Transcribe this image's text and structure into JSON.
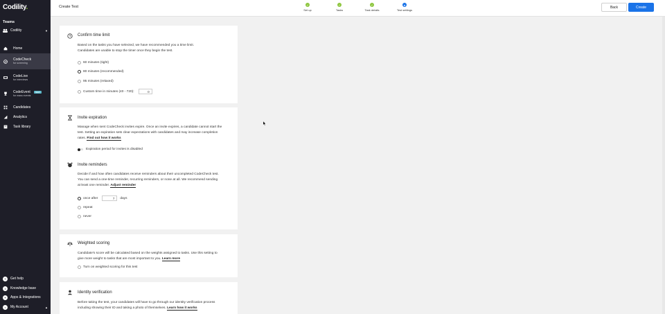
{
  "brand": {
    "logo_text": "Codility",
    "logo_dot": "."
  },
  "sidebar": {
    "teams_label": "Teams",
    "team_name": "Codility",
    "items": [
      {
        "label": "Home",
        "sub": ""
      },
      {
        "label": "CodeCheck",
        "sub": "for screening"
      },
      {
        "label": "CodeLive",
        "sub": "for interviews"
      },
      {
        "label": "CodeEvent",
        "sub": "for mass events",
        "badge": "NEW"
      },
      {
        "label": "Candidates",
        "sub": ""
      },
      {
        "label": "Analytics",
        "sub": ""
      },
      {
        "label": "Task library",
        "sub": ""
      }
    ],
    "bottom": [
      {
        "label": "Get help"
      },
      {
        "label": "Knowledge base"
      },
      {
        "label": "Apps & Integrations"
      },
      {
        "label": "My Account"
      }
    ]
  },
  "topbar": {
    "title": "Create Test",
    "steps": [
      "Set up",
      "Tasks",
      "Task details",
      "Test settings"
    ],
    "back_label": "Back",
    "create_label": "Create"
  },
  "time_limit": {
    "title": "Confirm time limit",
    "desc": "Based on the tasks you have selected, we have recommended you a time limit. Candidates are unable to stop the timer once they begin the test.",
    "options": [
      "60 minutes (tight)",
      "80 minutes (recommended)",
      "95 minutes (relaxed)",
      "Custom time in minutes (40 - 720):"
    ],
    "custom_value": "0"
  },
  "invite_expiration": {
    "title": "Invite expiration",
    "desc": "Manage when sent CodeCheck invites expire. Once an invite expires, a candidate cannot start the test. Setting an expiration sets clear expectations with candidates and may increase completion rates.",
    "link": "Find out how it works",
    "toggle_label": "Expiration period for invites is disabled"
  },
  "invite_reminders": {
    "title": "Invite reminders",
    "desc": "Decide if and how often candidates receive reminders about their uncompleted CodeCheck test. You can send a one-time reminder, recurring reminders, or none at all. We recommend sending at least one reminder.",
    "link": "Adjust reminder",
    "option_once": "once after",
    "once_value": "7",
    "once_unit": "days",
    "option_repeat": "repeat",
    "option_never": "never"
  },
  "weighted_scoring": {
    "title": "Weighted scoring",
    "desc": "Candidate's score will be calculated based on the weights assigned to tasks. Use this setting to give more weight to tasks that are most important to you.",
    "link": "Learn more",
    "toggle_label": "Turn on weighted scoring for this test"
  },
  "identity_verification": {
    "title": "Identity verification",
    "desc": "Before taking the test, your candidates will have to go through our identity verification process including showing their ID and taking a photo of themselves.",
    "link": "Learn how it works"
  },
  "colors": {
    "sidebar_bg": "#1e1e28",
    "accent": "#1a73e8",
    "step_done": "#8ec63f"
  }
}
